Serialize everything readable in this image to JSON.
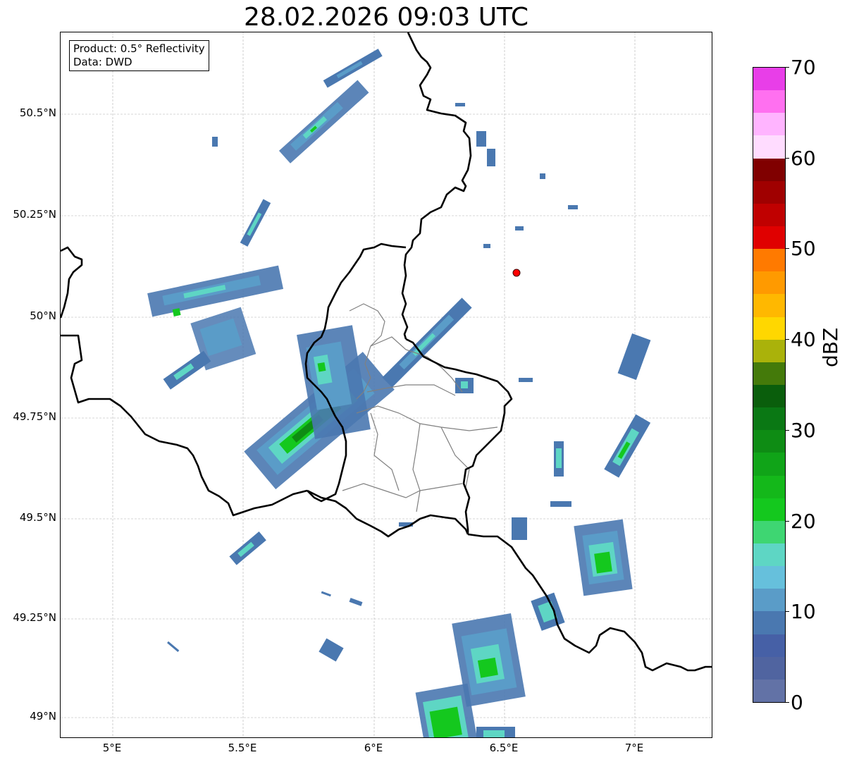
{
  "title": "28.02.2026 09:03 UTC",
  "info": {
    "product": "Product: 0.5° Reflectivity",
    "data": "Data: DWD"
  },
  "lat_ticks": [
    "50.5°N",
    "50.25°N",
    "50°N",
    "49.75°N",
    "49.5°N",
    "49.25°N",
    "49°N"
  ],
  "lon_ticks": [
    "5°E",
    "5.5°E",
    "6°E",
    "6.5°E",
    "7°E"
  ],
  "colorbar": {
    "unit": "dBZ",
    "labels": [
      "0",
      "10",
      "20",
      "30",
      "40",
      "50",
      "60",
      "70"
    ],
    "colors": [
      "#6272a6",
      "#5064a0",
      "#4660a6",
      "#4a78b0",
      "#5a9cc8",
      "#66c0dc",
      "#5ed6c4",
      "#3ed672",
      "#14c81e",
      "#14b81a",
      "#10a418",
      "#0e8c14",
      "#0a7814",
      "#0a5e0c",
      "#447a0a",
      "#aab20a",
      "#ffd700",
      "#ffb800",
      "#ff9a00",
      "#ff7a00",
      "#e00000",
      "#c00000",
      "#a00000",
      "#800000",
      "#ffdcff",
      "#ffb4ff",
      "#ff70f0",
      "#e83ee8"
    ]
  },
  "marker": {
    "color": "#ff0000",
    "lon": 6.54,
    "lat": 50.11
  },
  "colors": {
    "border": "#000000",
    "admin_border": "#808080",
    "grid": "#b0b0b0"
  }
}
